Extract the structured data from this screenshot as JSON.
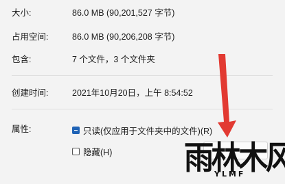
{
  "properties": {
    "size": {
      "label": "大小:",
      "value": "86.0 MB (90,201,527 字节)"
    },
    "size_on_disk": {
      "label": "占用空间:",
      "value": "86.0 MB (90,206,208 字节)"
    },
    "contains": {
      "label": "包含:",
      "value": "7 个文件，3 个文件夹"
    },
    "created": {
      "label": "创建时间:",
      "value": "2021年10月20日，上午 8:54:52"
    },
    "attributes": {
      "label": "属性:",
      "readonly_label": "只读(仅应用于文件夹中的文件)(R)",
      "hidden_label": "隐藏(H)"
    }
  },
  "watermark": {
    "text": "雨林木风",
    "sub": "YLMF"
  },
  "colors": {
    "background": "#f3f3f3",
    "checkbox_accent": "#1f63b6",
    "arrow": "#e23a32"
  }
}
